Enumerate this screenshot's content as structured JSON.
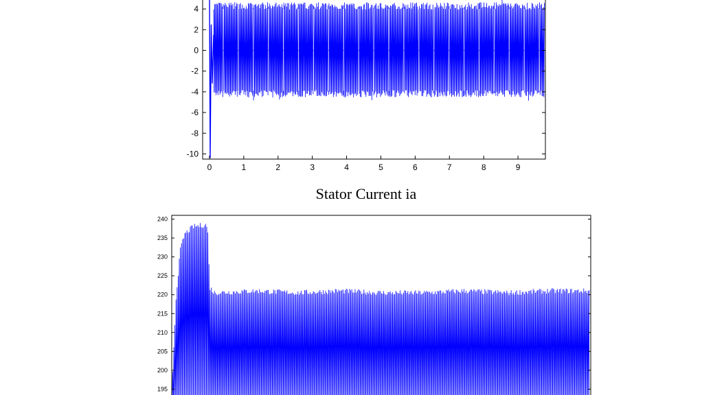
{
  "colors": {
    "trace": "#0000ff",
    "axis": "#000000",
    "background": "#ffffff"
  },
  "chart_data": [
    {
      "type": "line",
      "title": "",
      "xlabel": "",
      "ylabel": "",
      "xlim": [
        -0.2,
        9.8
      ],
      "ylim": [
        -10.5,
        5
      ],
      "x_ticks": [
        0,
        1,
        2,
        3,
        4,
        5,
        6,
        7,
        8,
        9
      ],
      "y_ticks": [
        -10,
        -8,
        -6,
        -4,
        -2,
        0,
        2,
        4
      ],
      "grid": false,
      "description_of_series": "dense oscillation",
      "series": [
        {
          "name": "",
          "transient": {
            "x": [
              0,
              0.02,
              0.05,
              0.08,
              0.12
            ],
            "y": [
              5,
              -10.4,
              2.5,
              -3.2,
              1.5
            ]
          },
          "envelope": {
            "x_start": 0.12,
            "x_end": 9.78,
            "upper": 4.3,
            "lower": -4.2,
            "peak_upper": 4.8,
            "peak_lower": -4.6
          }
        }
      ]
    },
    {
      "type": "line",
      "title": "",
      "xlabel": "",
      "ylabel": "",
      "ylim": [
        192,
        241
      ],
      "y_ticks": [
        195,
        200,
        205,
        210,
        215,
        220,
        225,
        230,
        235,
        240
      ],
      "grid": false,
      "series": [
        {
          "name": "",
          "profile": {
            "x_fraction": [
              0,
              0.01,
              0.02,
              0.03,
              0.05,
              0.08,
              0.085,
              0.09,
              0.1,
              0.2,
              0.3,
              0.4,
              0.5,
              0.6,
              0.7,
              0.8,
              0.9,
              1.0
            ],
            "peak": [
              196,
              220,
              232,
              236,
              238,
              238.5,
              238,
              222,
              220.5,
              221,
              220.5,
              221,
              220.5,
              220.5,
              221,
              220.5,
              221,
              221
            ]
          }
        }
      ]
    }
  ],
  "captions": {
    "middle": "Stator Current ia"
  }
}
